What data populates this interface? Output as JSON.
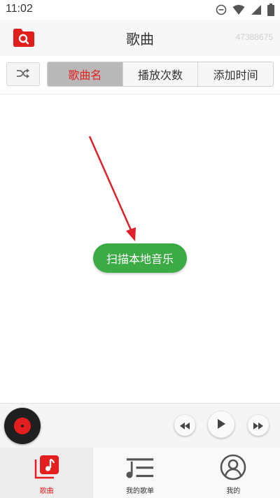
{
  "status": {
    "time": "11:02"
  },
  "header": {
    "title": "歌曲",
    "id_text": "47388675"
  },
  "sort_tabs": [
    {
      "label": "歌曲名",
      "active": true
    },
    {
      "label": "播放次数",
      "active": false
    },
    {
      "label": "添加时间",
      "active": false
    }
  ],
  "main": {
    "scan_button_label": "扫描本地音乐"
  },
  "bottom_nav": [
    {
      "label": "歌曲",
      "icon": "music-note-icon",
      "active": true
    },
    {
      "label": "我的歌单",
      "icon": "playlist-icon",
      "active": false
    },
    {
      "label": "我的",
      "icon": "user-icon",
      "active": false
    }
  ],
  "colors": {
    "accent": "#e41e1e",
    "scan_button": "#3caa45",
    "arrow": "#e0202a"
  }
}
